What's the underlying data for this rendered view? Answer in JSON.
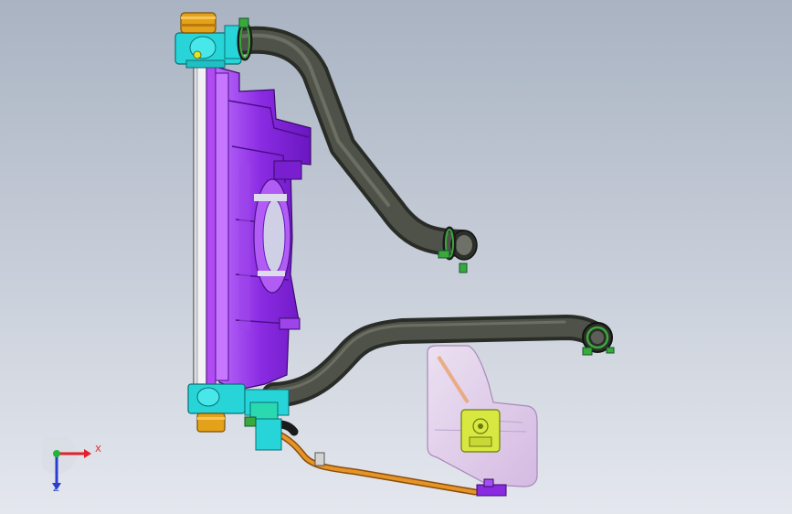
{
  "viewport": {
    "background_top": "#a9b3c2",
    "background_bottom": "#e3e7ee"
  },
  "model": {
    "parts": [
      {
        "name": "radiator-core",
        "color": "#e9e9ee"
      },
      {
        "name": "fan-shroud",
        "color": "#8a2be2"
      },
      {
        "name": "tanks",
        "color": "#27d5d9"
      },
      {
        "name": "upper-hose",
        "color": "#3a3d35"
      },
      {
        "name": "lower-hose",
        "color": "#3a3d35"
      },
      {
        "name": "overflow-tube",
        "color": "#e08a1c"
      },
      {
        "name": "reservoir",
        "color": "#dcc3e6"
      },
      {
        "name": "clamps",
        "color": "#3aa83a"
      },
      {
        "name": "radiator-cap",
        "color": "#e3a21a"
      }
    ]
  },
  "triad": {
    "x_label": "X",
    "z_label": "Z",
    "x_color": "#e2202a",
    "y_color": "#1fb43a",
    "z_color": "#2a3fd0"
  }
}
